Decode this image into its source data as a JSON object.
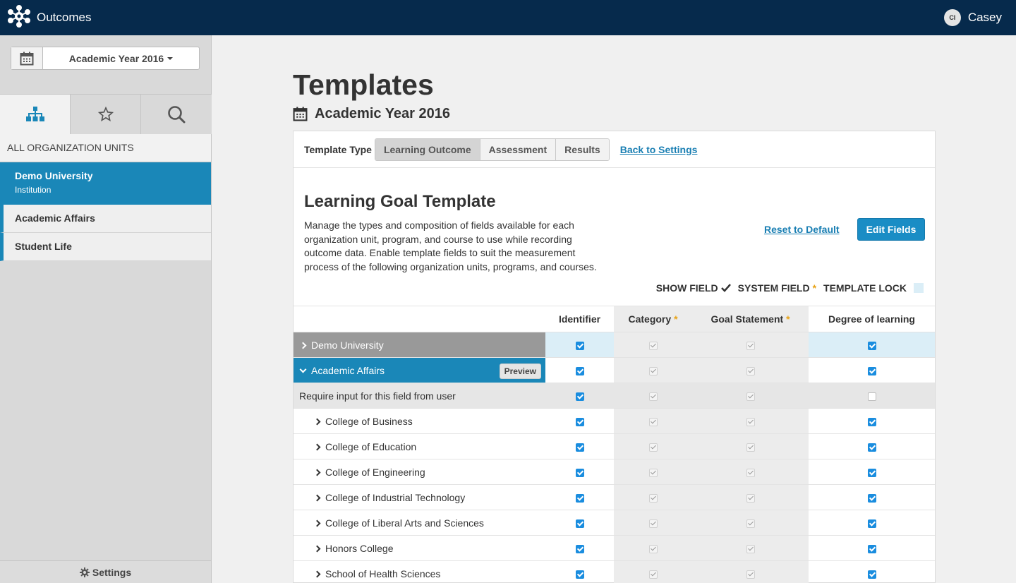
{
  "app": {
    "name": "Outcomes",
    "user_initials": "CI",
    "user_name": "Casey"
  },
  "sidebar": {
    "year_picker": "Academic Year 2016",
    "tabs": [
      "hierarchy",
      "favorites",
      "search"
    ],
    "org_header": "ALL ORGANIZATION UNITS",
    "items": [
      {
        "label": "Demo University",
        "sub": "Institution"
      },
      {
        "label": "Academic Affairs"
      },
      {
        "label": "Student Life"
      }
    ],
    "settings_label": "Settings"
  },
  "main": {
    "title": "Templates",
    "subtitle": "Academic Year 2016",
    "template_type_label": "Template Type",
    "template_types": [
      "Learning Outcome",
      "Assessment",
      "Results"
    ],
    "active_template_type": "Learning Outcome",
    "back_link": "Back to Settings",
    "template_title": "Learning Goal Template",
    "template_description": "Manage the types and composition of fields available for each organization unit, program, and course to use while recording outcome data. Enable template fields to suit the measurement process of the following organization units, programs, and courses.",
    "reset_link": "Reset to Default",
    "edit_button": "Edit Fields",
    "legend": {
      "show_field": "SHOW FIELD",
      "system_field": "SYSTEM FIELD",
      "system_marker": "*",
      "template_lock": "TEMPLATE LOCK"
    },
    "columns": [
      "Identifier",
      "Category",
      "Goal Statement",
      "Degree of learning"
    ],
    "column_markers": [
      "",
      "*",
      "*",
      ""
    ],
    "preview_button": "Preview",
    "require_row": "Require input for this field from user",
    "rows": [
      {
        "label": "Demo University",
        "state": "collapsed"
      },
      {
        "label": "Academic Affairs",
        "state": "expanded"
      },
      {
        "label": "College of Business"
      },
      {
        "label": "College of Education"
      },
      {
        "label": "College of Engineering"
      },
      {
        "label": "College of Industrial Technology"
      },
      {
        "label": "College of Liberal Arts and Sciences"
      },
      {
        "label": "Honors College"
      },
      {
        "label": "School of Health Sciences"
      }
    ]
  },
  "colors": {
    "topbar": "#062a4c",
    "accent": "#1a87b8",
    "link": "#1a7fb3",
    "lock": "#dbeef7",
    "system_star": "#e8a317"
  }
}
